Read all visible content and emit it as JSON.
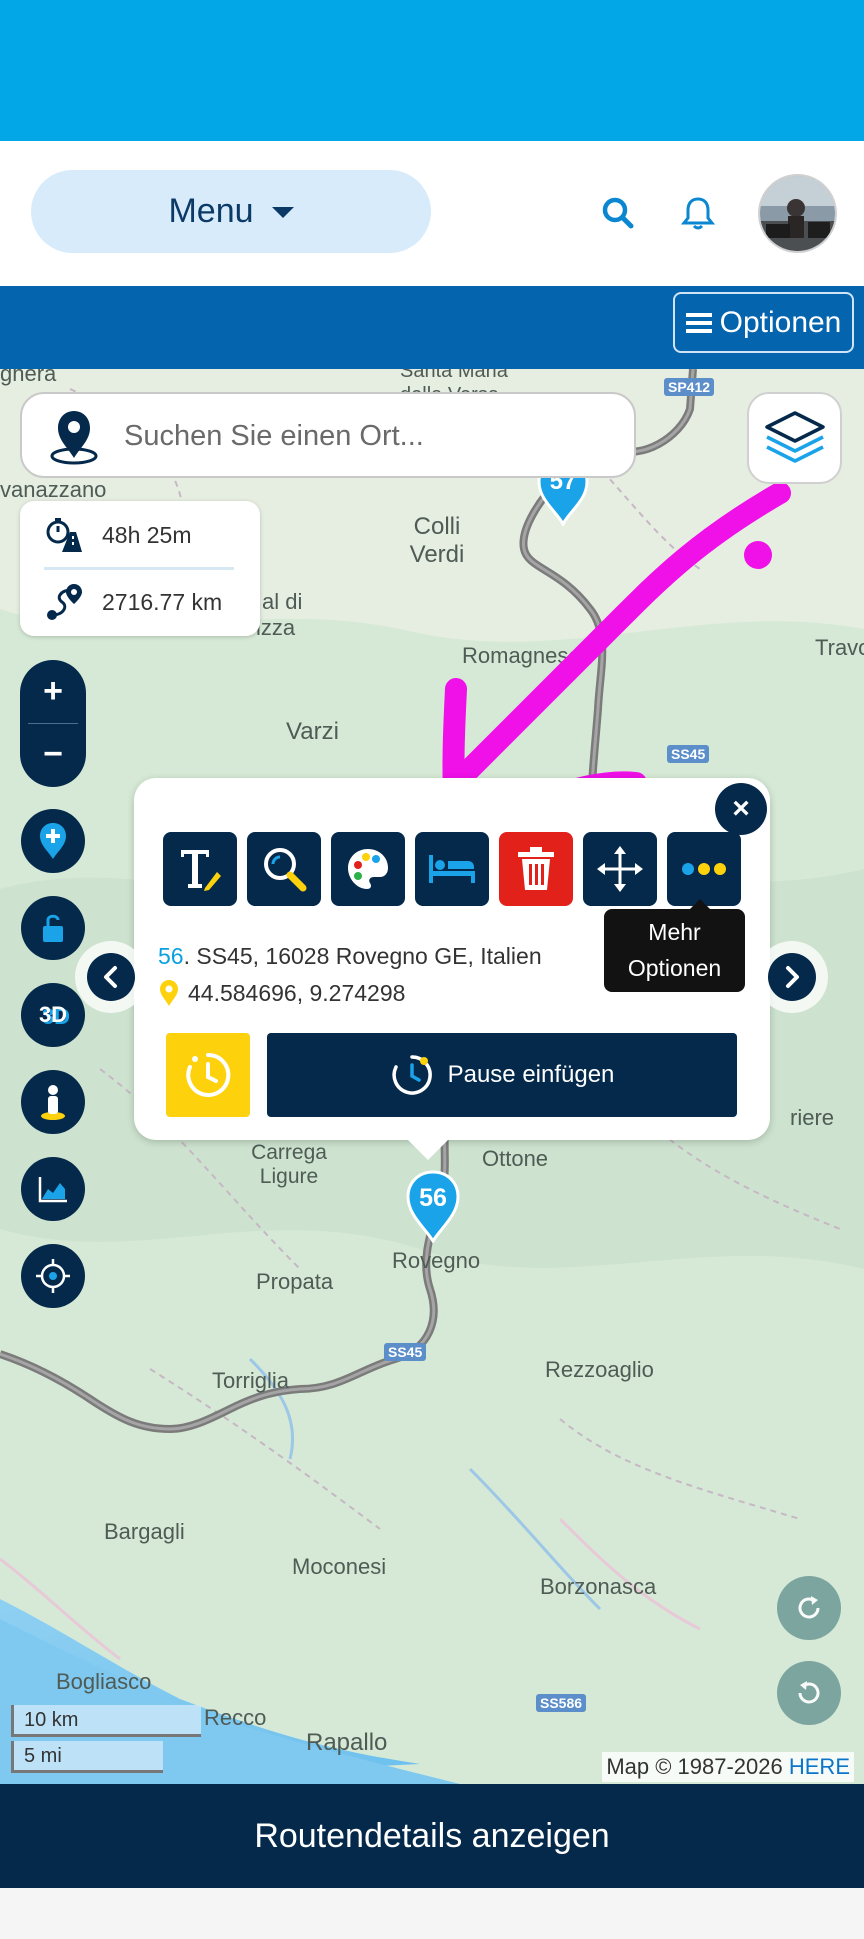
{
  "header": {
    "menu_label": "Menu",
    "options_label": "Optionen"
  },
  "search": {
    "placeholder": "Suchen Sie einen Ort..."
  },
  "stats": {
    "duration": "48h 25m",
    "distance": "2716.77 km"
  },
  "map_controls": {
    "zoom_in": "+",
    "zoom_out": "−",
    "three_d": "3D"
  },
  "map_labels": [
    {
      "text": "ghera"
    },
    {
      "text": "Santa Maria della Versa"
    },
    {
      "text": "vanazzano"
    },
    {
      "text": "Colli Verdi"
    },
    {
      "text": "al di"
    },
    {
      "text": "izza"
    },
    {
      "text": "Travo"
    },
    {
      "text": "Romagnese"
    },
    {
      "text": "Varzi"
    },
    {
      "text": "Carrega Ligure"
    },
    {
      "text": "Ottone"
    },
    {
      "text": "Rovegno"
    },
    {
      "text": "Propata"
    },
    {
      "text": "Torriglia"
    },
    {
      "text": "Rezzoaglio"
    },
    {
      "text": "Bargagli"
    },
    {
      "text": "Moconesi"
    },
    {
      "text": "Borzonasca"
    },
    {
      "text": "Bogliasco"
    },
    {
      "text": "Recco"
    },
    {
      "text": "Rapallo"
    },
    {
      "text": "riere"
    }
  ],
  "road_shields": [
    "SP412",
    "SS45",
    "SS45",
    "SS586"
  ],
  "waypoints": {
    "current": "56",
    "previous": "57"
  },
  "popup": {
    "tooltip": "Mehr Optionen",
    "address_number": "56",
    "address": ". SS45, 16028 Rovegno GE, Italien",
    "coordinates": "44.584696, 9.274298",
    "pause_label": "Pause einfügen",
    "close": "×"
  },
  "scale": {
    "km": "10 km",
    "mi": "5 mi"
  },
  "attribution": {
    "prefix": "Map © 1987-2026 ",
    "provider": "HERE"
  },
  "bottom": {
    "details_label": "Routendetails anzeigen"
  },
  "colors": {
    "status_bar": "#01a7e6",
    "options_bar": "#0464ae",
    "dark_navy": "#04294b",
    "delete_red": "#e3211b",
    "timer_yellow": "#fdd20d",
    "marker_blue": "#1aa3e8",
    "annotation_magenta": "#f010e8"
  }
}
